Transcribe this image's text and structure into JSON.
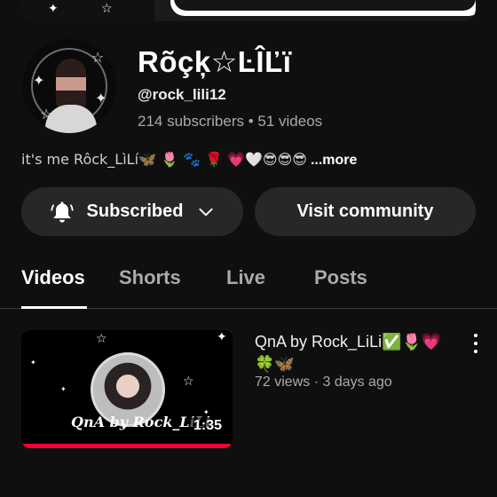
{
  "channel": {
    "name": "Rõçķ☆ĿÎĽï",
    "handle": "@rock_lili12",
    "meta": "214 subscribers • 51 videos",
    "description": "it's me Rôck_LìLí🦋 🌷 🐾 🌹 💗🤍😎😎😎",
    "more_label": "...more"
  },
  "actions": {
    "subscribed_label": "Subscribed",
    "community_label": "Visit community"
  },
  "tabs": [
    {
      "label": "Videos",
      "active": true
    },
    {
      "label": "Shorts",
      "active": false
    },
    {
      "label": "Live",
      "active": false
    },
    {
      "label": "Posts",
      "active": false
    }
  ],
  "videos": [
    {
      "title": "QnA by Rock_LiLi✅🌷💗🍀🦋",
      "views_age": "72 views · 3 days ago",
      "duration": "1:35",
      "thumb_text": "QnA by Rock_LiLi",
      "watched_fraction": 1.0
    }
  ],
  "colors": {
    "background": "#0f0f0f",
    "button": "#272727",
    "muted_text": "#aaaaaa",
    "progress": "#ff0033"
  }
}
